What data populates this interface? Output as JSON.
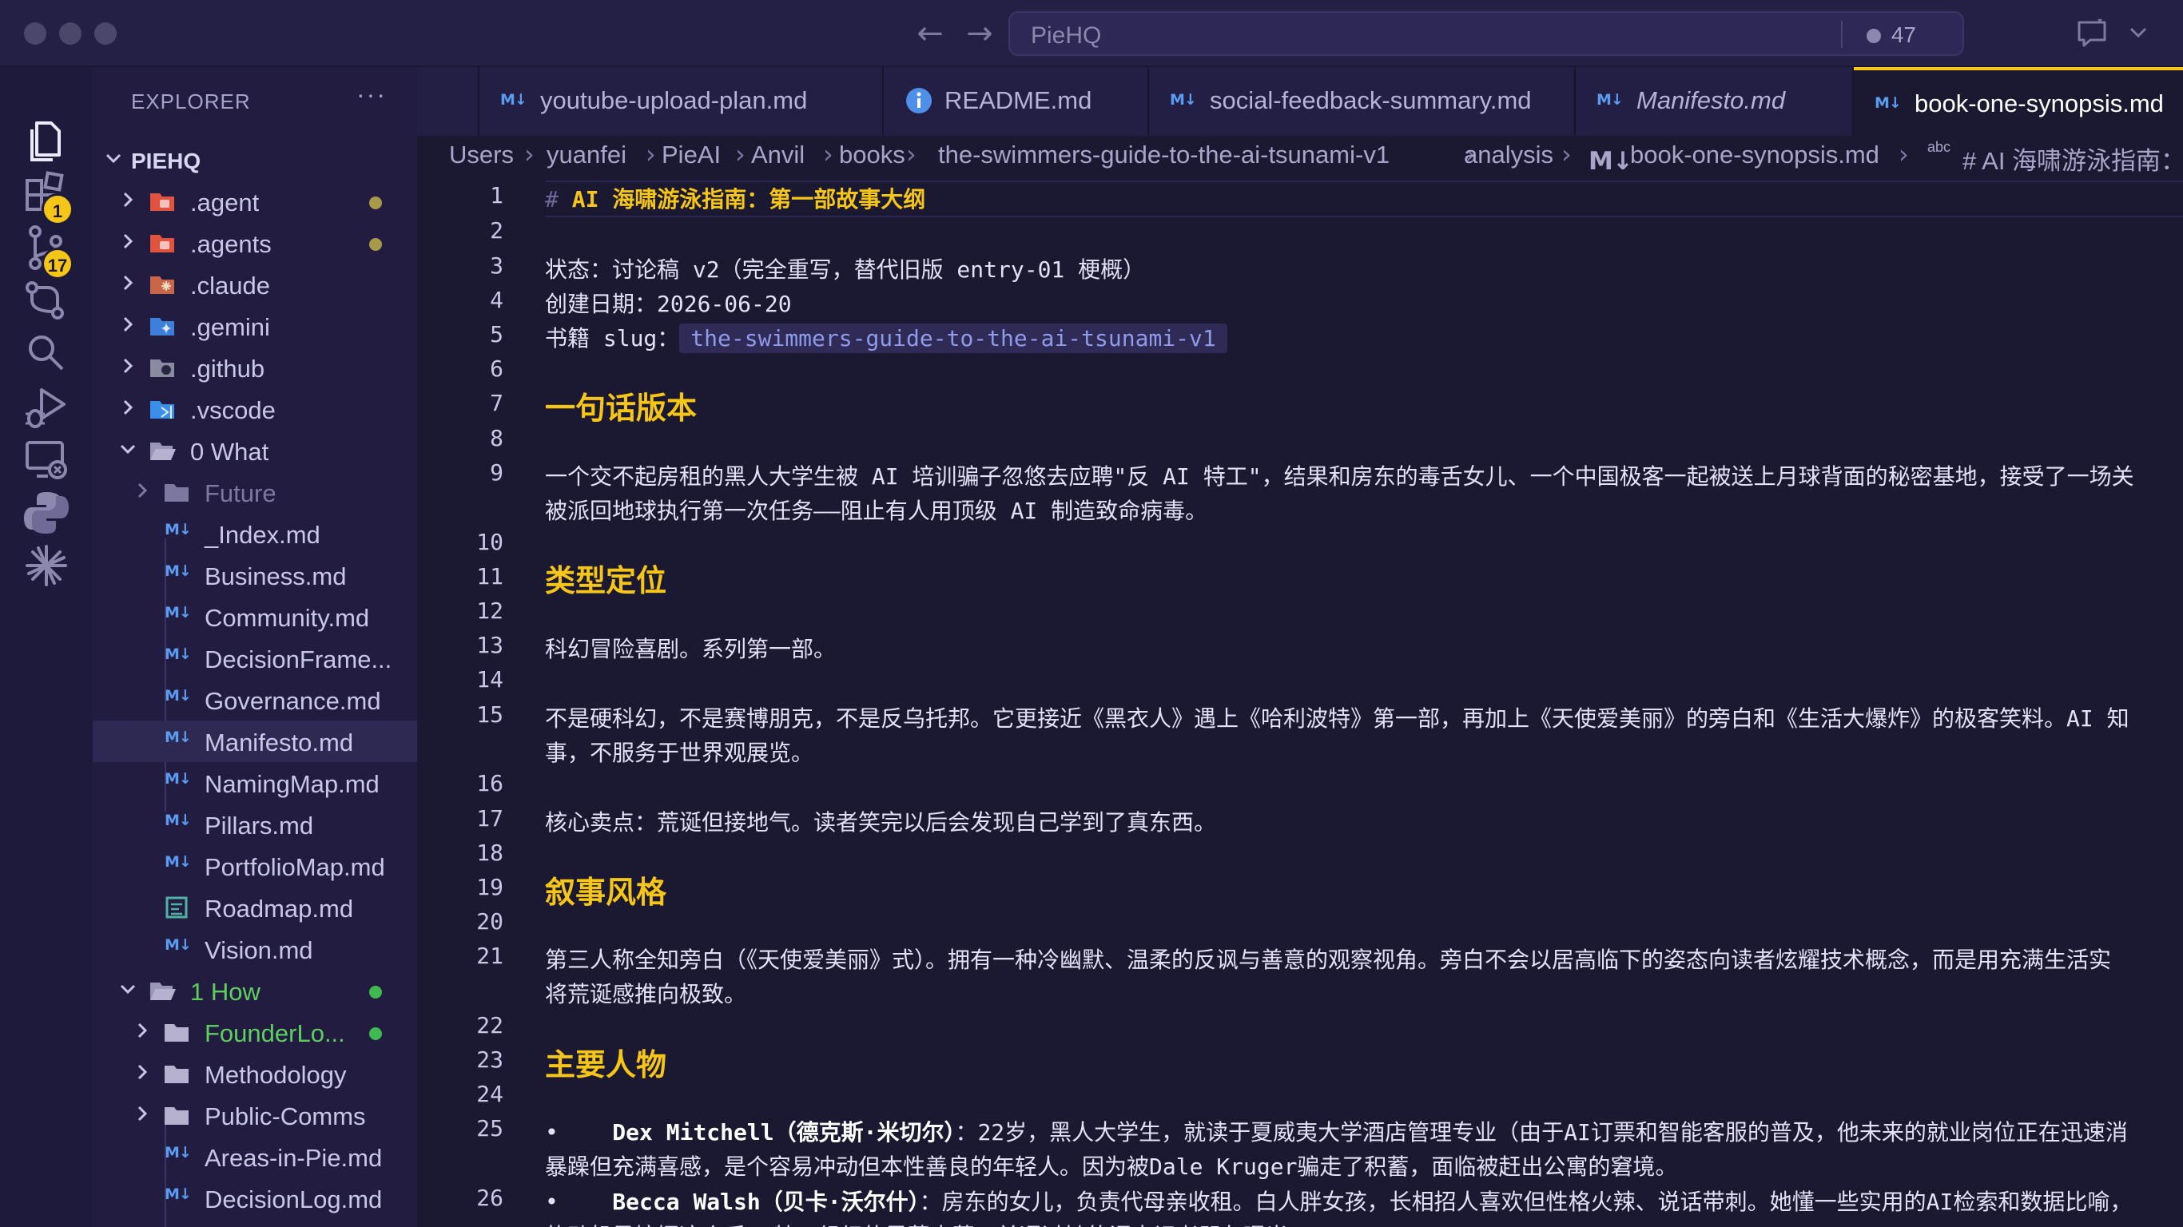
{
  "window": {
    "search_text": "PieHQ",
    "notif_count": "47"
  },
  "activity": {
    "extensions_badge": "1",
    "scm_badge": "17"
  },
  "sidebar": {
    "title": "EXPLORER",
    "more": "···",
    "root": "PIEHQ",
    "items": [
      {
        "label": ".agent"
      },
      {
        "label": ".agents"
      },
      {
        "label": ".claude"
      },
      {
        "label": ".gemini"
      },
      {
        "label": ".github"
      },
      {
        "label": ".vscode"
      },
      {
        "label": "0 What"
      },
      {
        "label": "Future"
      },
      {
        "label": "_Index.md"
      },
      {
        "label": "Business.md"
      },
      {
        "label": "Community.md"
      },
      {
        "label": "DecisionFrame..."
      },
      {
        "label": "Governance.md"
      },
      {
        "label": "Manifesto.md"
      },
      {
        "label": "NamingMap.md"
      },
      {
        "label": "Pillars.md"
      },
      {
        "label": "PortfolioMap.md"
      },
      {
        "label": "Roadmap.md"
      },
      {
        "label": "Vision.md"
      },
      {
        "label": "1 How"
      },
      {
        "label": "FounderLo..."
      },
      {
        "label": "Methodology"
      },
      {
        "label": "Public-Comms"
      },
      {
        "label": "Areas-in-Pie.md"
      },
      {
        "label": "DecisionLog.md"
      }
    ]
  },
  "tabs": [
    {
      "label": "youtube-upload-plan.md"
    },
    {
      "label": "README.md"
    },
    {
      "label": "social-feedback-summary.md"
    },
    {
      "label": "Manifesto.md"
    },
    {
      "label": "book-one-synopsis.md"
    }
  ],
  "breadcrumb": [
    "Users",
    "yuanfei",
    "PieAI",
    "Anvil",
    "books",
    "the-swimmers-guide-to-the-ai-tsunami-v1",
    "analysis",
    "book-one-synopsis.md",
    "# AI 海啸游泳指南："
  ],
  "breadcrumb_abc": "abc",
  "editor": {
    "line_numbers": [
      "1",
      "2",
      "3",
      "4",
      "5",
      "6",
      "7",
      "8",
      "9",
      "10",
      "11",
      "12",
      "13",
      "14",
      "15",
      "16",
      "17",
      "18",
      "19",
      "20",
      "21",
      "22",
      "23",
      "24",
      "25",
      "26"
    ],
    "h1_hash": "#",
    "h1_text": "AI 海啸游泳指南：第一部故事大纲",
    "l3": "状态：讨论稿 v2（完全重写，替代旧版 entry-01 梗概）",
    "l4": "创建日期：2026-06-20",
    "l5_prefix": "书籍 slug：",
    "l5_slug": "the-swimmers-guide-to-the-ai-tsunami-v1",
    "l7": "一句话版本",
    "l9a": "一个交不起房租的黑人大学生被 AI 培训骗子忽悠去应聘\"反 AI 特工\"，结果和房东的毒舌女儿、一个中国极客一起被送上月球背面的秘密基地，接受了一场关",
    "l9b": "被派回地球执行第一次任务——阻止有人用顶级 AI 制造致命病毒。",
    "l11": "类型定位",
    "l13": "科幻冒险喜剧。系列第一部。",
    "l15a": "不是硬科幻，不是赛博朋克，不是反乌托邦。它更接近《黑衣人》遇上《哈利波特》第一部，再加上《天使爱美丽》的旁白和《生活大爆炸》的极客笑料。AI 知",
    "l15b": "事，不服务于世界观展览。",
    "l17": "核心卖点：荒诞但接地气。读者笑完以后会发现自己学到了真东西。",
    "l19": "叙事风格",
    "l21a": "第三人称全知旁白（《天使爱美丽》式）。拥有一种冷幽默、温柔的反讽与善意的观察视角。旁白不会以居高临下的姿态向读者炫耀技术概念，而是用充满生活实",
    "l21b": "将荒诞感推向极致。",
    "l23": "主要人物",
    "l25_bullet": "•",
    "l25_name": "Dex Mitchell（德克斯·米切尔）",
    "l25a": "：22岁，黑人大学生，就读于夏威夷大学酒店管理专业（由于AI订票和智能客服的普及，他未来的就业岗位正在迅速消",
    "l25b": "暴躁但充满喜感，是个容易冲动但本性善良的年轻人。因为被Dale Kruger骗走了积蓄，面临被赶出公寓的窘境。",
    "l26_bullet": "•",
    "l26_name": "Becca Walsh（贝卡·沃尔什）",
    "l26a": "：房东的女儿，负责代母亲收租。白人胖女孩，长相招人喜欢但性格火辣、说话带刺。她懂一些实用的AI检索和数据比喻，",
    "l26b": "的动机是挖掘这个反AI特工组织的黑幕内幕，并通过她的调查记者朋友曝光。"
  },
  "colors": {
    "accent": "#f5c518",
    "md_icon": "#5a9cf0",
    "modified_dot": "#a89a4a",
    "git_dot": "#3fb950"
  }
}
